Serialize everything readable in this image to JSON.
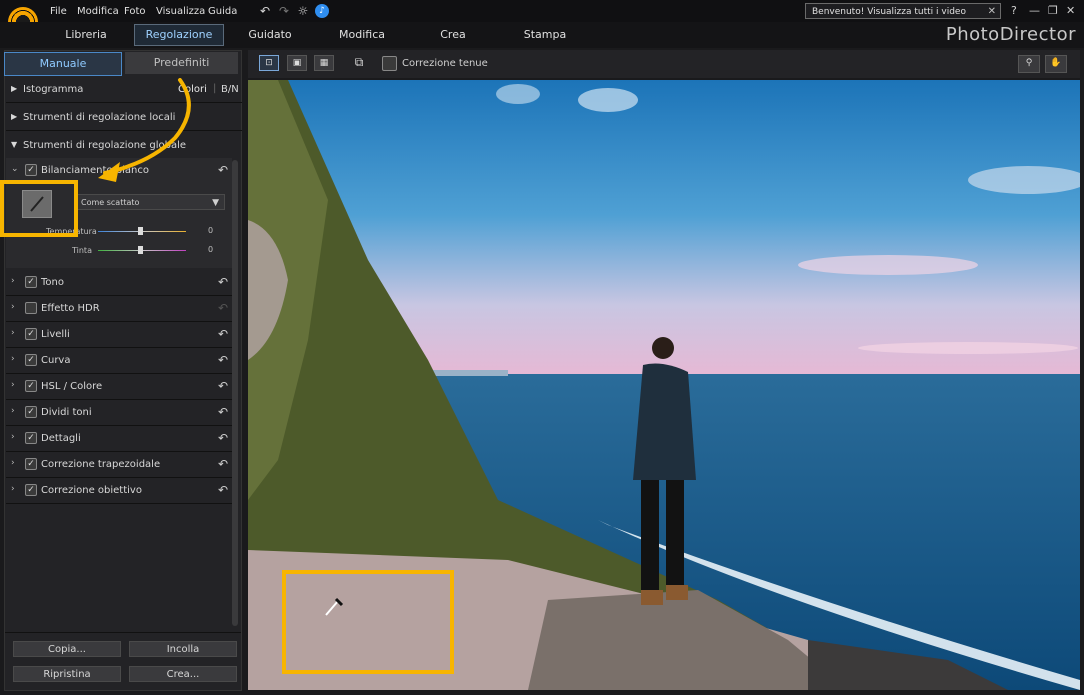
{
  "menu": {
    "items": [
      "File",
      "Modifica",
      "Foto",
      "Visualizza",
      "Guida"
    ]
  },
  "tip": {
    "text": "Benvenuto! Visualizza tutti i video tutorial qui!",
    "close": "✕"
  },
  "window": {
    "help": "?",
    "minimize": "—",
    "restore": "❐",
    "close": "✕"
  },
  "nav": {
    "tabs": [
      "Libreria",
      "Regolazione",
      "Guidato",
      "Modifica",
      "Crea",
      "Stampa"
    ],
    "active": "Regolazione"
  },
  "brand": "PhotoDirector",
  "panel": {
    "tabs": {
      "manual": "Manuale",
      "presets": "Predefiniti"
    },
    "histogram": {
      "label": "Istogramma",
      "colors": "Colori",
      "bw": "B/N"
    },
    "local_tools": "Strumenti di regolazione locali",
    "global_tools": "Strumenti di regolazione globale",
    "white_balance": {
      "label": "Bilanciamento bianco",
      "preset": "Come scattato",
      "temp_label": "Temperatura",
      "temp_value": "0",
      "tint_label": "Tinta",
      "tint_value": "0"
    },
    "modules": [
      "Tono",
      "Effetto HDR",
      "Livelli",
      "Curva",
      "HSL / Colore",
      "Dividi toni",
      "Dettagli",
      "Correzione trapezoidale",
      "Correzione obiettivo"
    ],
    "buttons": {
      "copy": "Copia...",
      "paste": "Incolla",
      "reset": "Ripristina",
      "create": "Crea..."
    }
  },
  "toolbar": {
    "soft_correction": "Correzione tenue"
  },
  "colors": {
    "accent": "#f7b500",
    "active_tab": "#8fcaff"
  }
}
